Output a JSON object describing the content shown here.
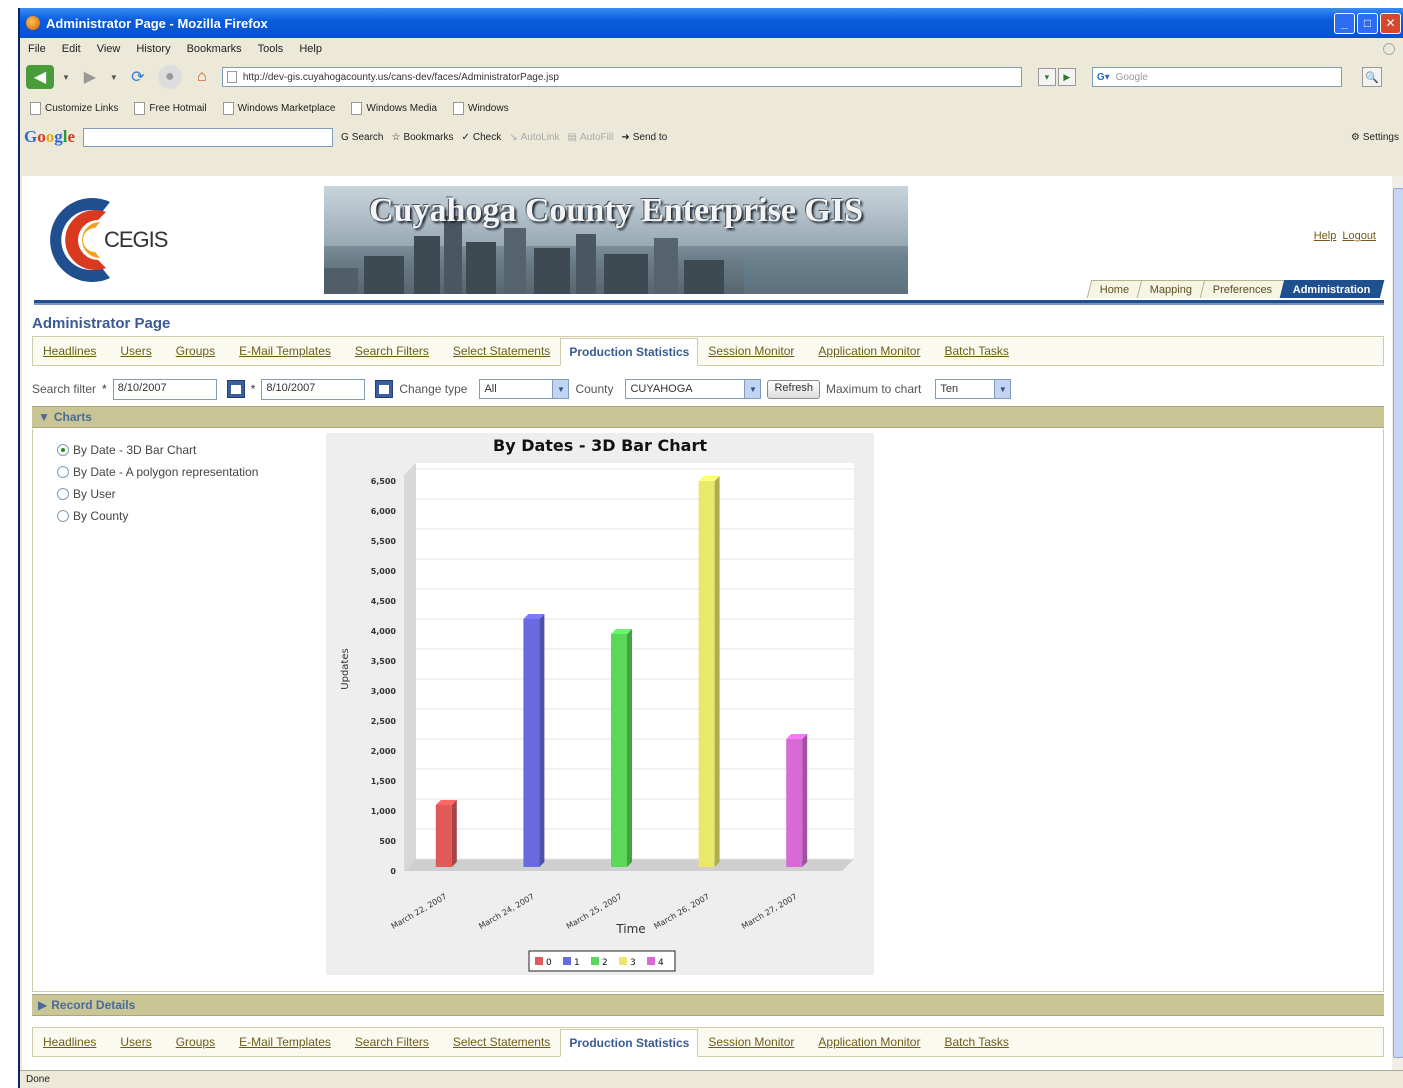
{
  "browser": {
    "window_title": "Administrator Page - Mozilla Firefox",
    "menu": [
      "File",
      "Edit",
      "View",
      "History",
      "Bookmarks",
      "Tools",
      "Help"
    ],
    "url": "http://dev-gis.cuyahogacounty.us/cans-dev/faces/AdministratorPage.jsp",
    "search_placeholder": "Google",
    "bookmarks": [
      "Customize Links",
      "Free Hotmail",
      "Windows Marketplace",
      "Windows Media",
      "Windows"
    ],
    "google_toolbar": {
      "logo": [
        "G",
        "o",
        "o",
        "g",
        "l",
        "e"
      ],
      "tools": [
        "Search",
        "Bookmarks",
        "Check",
        "AutoLink",
        "AutoFill",
        "Send to"
      ],
      "settings": "Settings"
    },
    "status": "Done"
  },
  "app": {
    "logo_text": "CEGIS",
    "header_title": "Cuyahoga County Enterprise GIS",
    "top_links": [
      "Help",
      "Logout"
    ],
    "main_tabs": [
      "Home",
      "Mapping",
      "Preferences",
      "Administration"
    ],
    "main_tab_active": "Administration",
    "page_title": "Administrator Page",
    "sub_tabs": [
      "Headlines",
      "Users",
      "Groups",
      "E-Mail Templates",
      "Search Filters",
      "Select Statements",
      "Production Statistics",
      "Session Monitor",
      "Application Monitor",
      "Batch Tasks"
    ],
    "sub_tab_active": "Production Statistics",
    "filters": {
      "search_filter_label": "Search filter",
      "required_mark": "*",
      "date_from": "8/10/2007",
      "date_to": "8/10/2007",
      "change_type_label": "Change type",
      "change_type_value": "All",
      "county_label": "County",
      "county_value": "CUYAHOGA",
      "refresh_label": "Refresh",
      "max_chart_label": "Maximum to chart",
      "max_chart_value": "Ten"
    },
    "charts_section": "Charts",
    "record_section": "Record Details",
    "chart_options": [
      "By Date - 3D Bar Chart",
      "By Date - A polygon representation",
      "By User",
      "By County"
    ],
    "chart_option_selected": 0
  },
  "chart_data": {
    "type": "bar",
    "title": "By Dates - 3D Bar Chart",
    "xlabel": "Time",
    "ylabel": "Updates",
    "ylim": [
      0,
      6500
    ],
    "yticks": [
      0,
      500,
      1000,
      1500,
      2000,
      2500,
      3000,
      3500,
      4000,
      4500,
      5000,
      5500,
      6000,
      6500
    ],
    "categories": [
      "March 22, 2007",
      "March 24, 2007",
      "March 25, 2007",
      "March 26, 2007",
      "March 27, 2007"
    ],
    "values": [
      1100,
      4200,
      3950,
      6500,
      2200
    ],
    "colors": [
      "#e05a5a",
      "#6a6ae0",
      "#5ad85a",
      "#e8e86a",
      "#d86ad8"
    ],
    "legend": [
      "0",
      "1",
      "2",
      "3",
      "4"
    ],
    "legend_placement": "bottom",
    "grid": true
  }
}
